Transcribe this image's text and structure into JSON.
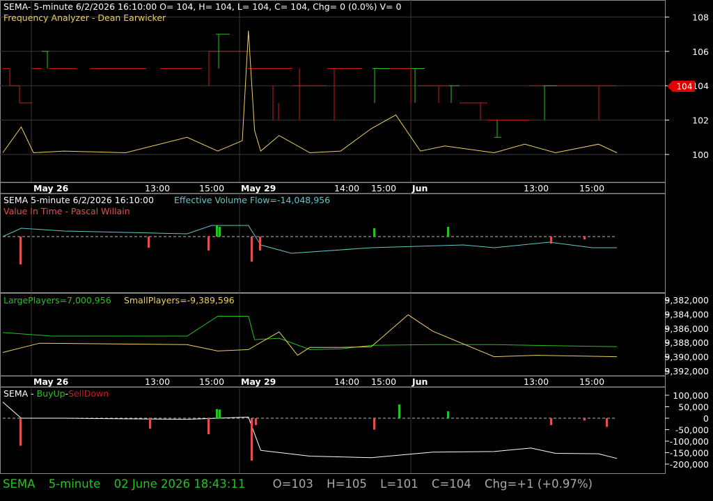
{
  "colors": {
    "background": "#000000",
    "grid": "#3a3a3a",
    "frame": "#8a8a8a",
    "green": "#22c322",
    "red": "#d11a1a",
    "yellow": "#f0d060",
    "cyan": "#60c8c8",
    "white": "#ffffff",
    "pink": "#e05050",
    "price_tag": "#e00000"
  },
  "panel1": {
    "header": "SEMA- 5-minute 6/2/2026 16:10:00 O= 104, H= 104, L= 104, C= 104, Chg= 0 (0.0%) V= 0",
    "indicator": "Frequency Analyzer - Dean Earwicker",
    "price_tag": "104",
    "y_ticks": [
      "108",
      "106",
      "104",
      "102",
      "100"
    ]
  },
  "date_axis": {
    "labels": [
      "May 26",
      "13:00",
      "15:00",
      "May 29",
      "14:00",
      "15:00",
      "Jun",
      "13:00",
      "15:00"
    ],
    "bold": [
      true,
      false,
      false,
      true,
      false,
      false,
      true,
      false,
      false
    ]
  },
  "panel2": {
    "header_left": "SEMA 5-minute  6/2/2026 16:10:00",
    "header_right": "Effective Volume Flow=-14,048,956",
    "indicator": "Value In Time - Pascal Willain"
  },
  "panel3": {
    "large": "LargePlayers=7,000,956",
    "small": "SmallPlayers=-9,389,596",
    "y_ticks": [
      "9,382,000",
      "9,384,000",
      "9,386,000",
      "9,388,000",
      "9,390,000",
      "9,392,000"
    ]
  },
  "panel4": {
    "title_a": "SEMA - ",
    "title_b": "BuyUp",
    "title_c": "-",
    "title_d": "SellDown",
    "y_ticks": [
      "100,000",
      "50,000",
      "0",
      "-50,000",
      "-100,000",
      "-150,000",
      "-200,000"
    ]
  },
  "status": {
    "symbol": "SEMA",
    "interval": "5-minute",
    "datetime": "02 June 2026 18:43:11",
    "open": "O=103",
    "high": "H=105",
    "low": "L=101",
    "close": "C=104",
    "change": "Chg=+1 (+0.97%)"
  },
  "chart_data": {
    "type": "line",
    "x": [
      "May 26",
      "13:00",
      "15:00",
      "May 29",
      "14:00",
      "15:00",
      "Jun",
      "13:00",
      "15:00"
    ],
    "price_ylim": [
      98.5,
      109
    ],
    "price_last": 104,
    "frequency_series": {
      "name": "Frequency Analyzer",
      "t": [
        0,
        0.03,
        0.05,
        0.1,
        0.2,
        0.3,
        0.35,
        0.39,
        0.4,
        0.41,
        0.42,
        0.45,
        0.5,
        0.55,
        0.6,
        0.64,
        0.68,
        0.72,
        0.8,
        0.85,
        0.9,
        0.97,
        1
      ],
      "values": [
        100.1,
        101.6,
        100.1,
        100.2,
        100.1,
        101,
        100.2,
        100.8,
        107.2,
        101.4,
        100.2,
        101.1,
        100.1,
        100.2,
        101.5,
        102.3,
        100.2,
        100.5,
        100.1,
        100.6,
        100.1,
        100.6,
        100.1
      ]
    },
    "effective_volume_flow": {
      "name": "Effective Volume Flow",
      "t": [
        0,
        0.03,
        0.1,
        0.3,
        0.34,
        0.4,
        0.42,
        0.47,
        0.6,
        0.75,
        0.8,
        0.89,
        0.96,
        1
      ],
      "values": [
        0.95,
        0.98,
        0.97,
        0.96,
        0.99,
        0.99,
        0.92,
        0.89,
        0.91,
        0.92,
        0.91,
        0.93,
        0.91,
        0.91
      ]
    },
    "players_ylim": [
      9382000,
      9392000
    ],
    "large_players": {
      "name": "LargePlayers",
      "t": [
        0,
        0.08,
        0.3,
        0.35,
        0.4,
        0.41,
        0.45,
        0.5,
        0.55,
        0.6,
        0.7,
        0.8,
        1
      ],
      "values": [
        9386600,
        9387100,
        9387100,
        9384300,
        9384300,
        9387600,
        9387400,
        9389000,
        9388900,
        9388400,
        9388300,
        9388300,
        9388600
      ]
    },
    "small_players": {
      "name": "SmallPlayers",
      "t": [
        0,
        0.06,
        0.3,
        0.35,
        0.4,
        0.45,
        0.48,
        0.5,
        0.55,
        0.6,
        0.66,
        0.7,
        0.8,
        0.87,
        1
      ],
      "values": [
        9389400,
        9388100,
        9388300,
        9389200,
        9389000,
        9386500,
        9389800,
        9388700,
        9388700,
        9388600,
        9384100,
        9386400,
        9390000,
        9389800,
        9390000
      ]
    },
    "buyup_selldown_ylim": [
      -200000,
      110000
    ],
    "buyup_selldown": {
      "name": "BuyUp-SellDown",
      "t": [
        0,
        0.03,
        0.1,
        0.3,
        0.35,
        0.4,
        0.42,
        0.5,
        0.6,
        0.7,
        0.8,
        0.86,
        0.9,
        0.97,
        1
      ],
      "values": [
        70000,
        0,
        0,
        -5000,
        0,
        5000,
        -140000,
        -165000,
        -172000,
        -148000,
        -145000,
        -130000,
        -153000,
        -155000,
        -175000
      ]
    }
  }
}
